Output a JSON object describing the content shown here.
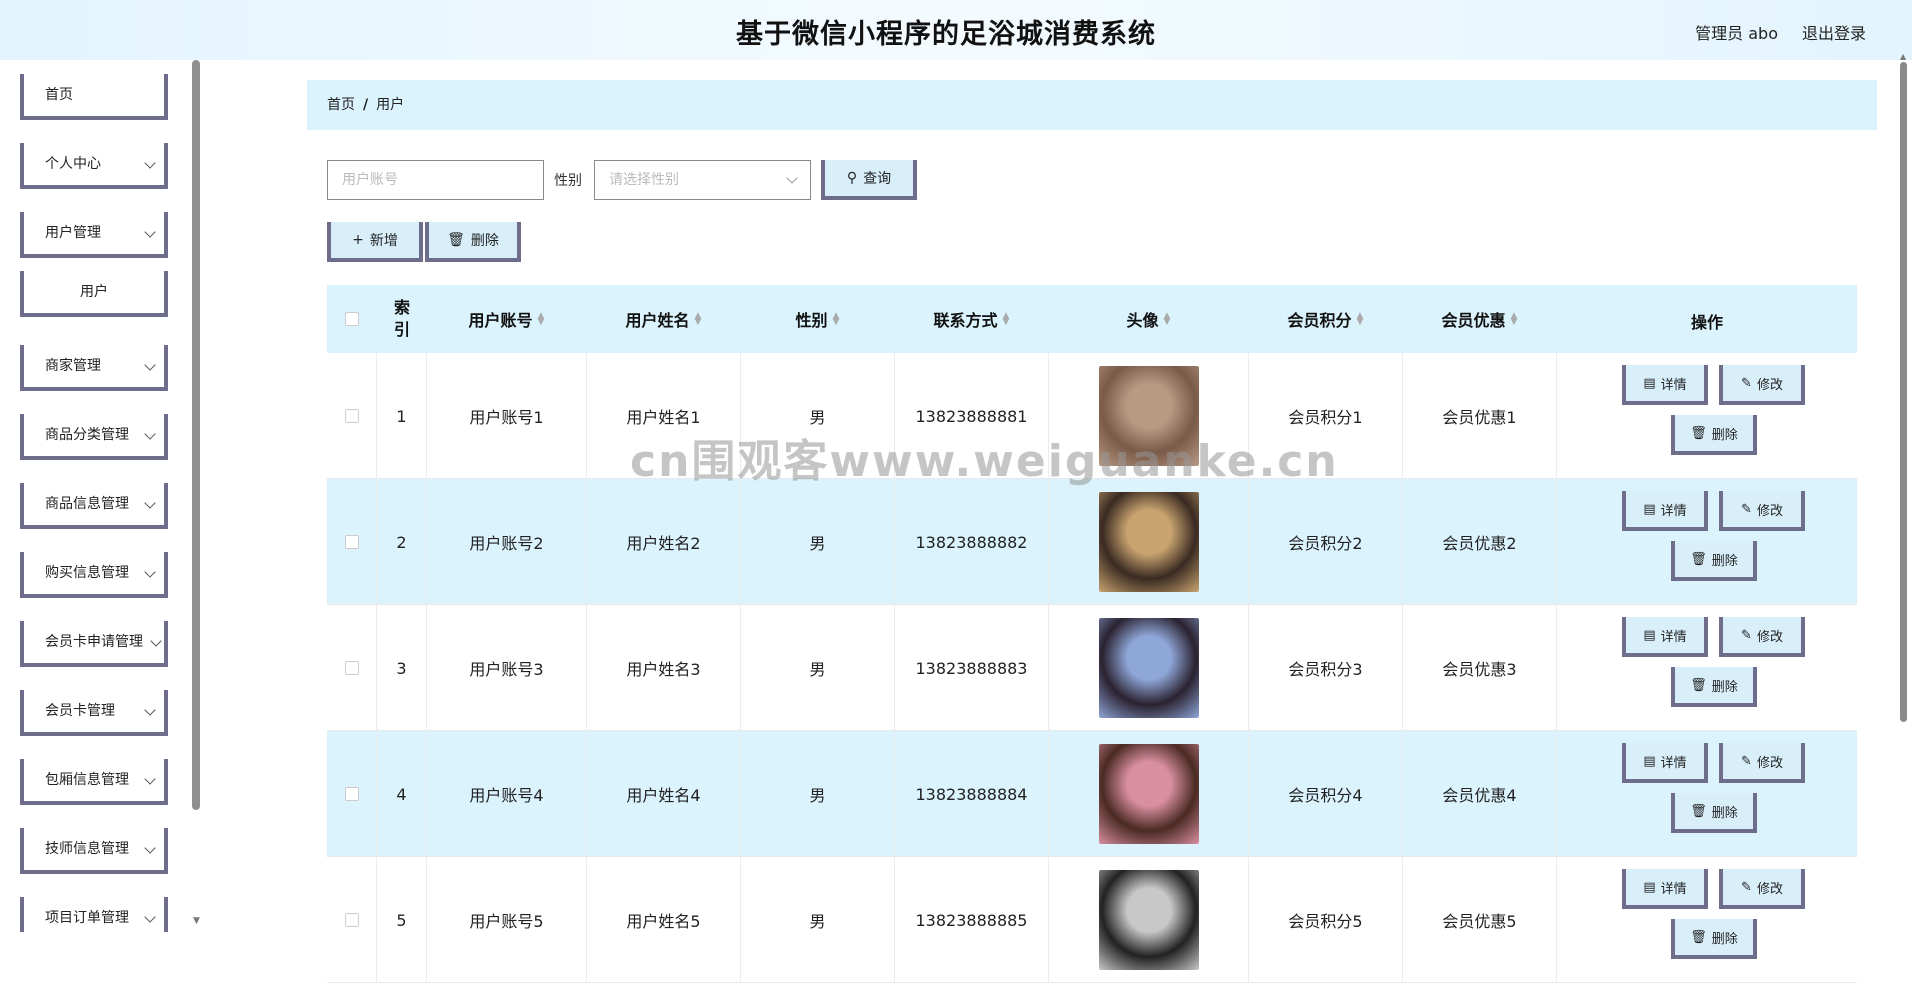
{
  "header": {
    "title": "基于微信小程序的足浴城消费系统",
    "admin": "管理员 abo",
    "logout": "退出登录"
  },
  "sidebar": {
    "items": [
      {
        "label": "首页",
        "has_chevron": false
      },
      {
        "label": "个人中心",
        "has_chevron": true
      },
      {
        "label": "用户管理",
        "has_chevron": true
      },
      {
        "label": "商家管理",
        "has_chevron": true
      },
      {
        "label": "商品分类管理",
        "has_chevron": true
      },
      {
        "label": "商品信息管理",
        "has_chevron": true
      },
      {
        "label": "购买信息管理",
        "has_chevron": true
      },
      {
        "label": "会员卡申请管理",
        "has_chevron": true
      },
      {
        "label": "会员卡管理",
        "has_chevron": true
      },
      {
        "label": "包厢信息管理",
        "has_chevron": true
      },
      {
        "label": "技师信息管理",
        "has_chevron": true
      },
      {
        "label": "项目订单管理",
        "has_chevron": true
      }
    ],
    "submenu": {
      "label": "用户"
    }
  },
  "breadcrumb": {
    "home": "首页",
    "separator": "/",
    "current": "用户"
  },
  "search": {
    "account_placeholder": "用户账号",
    "gender_label": "性别",
    "gender_placeholder": "请选择性别",
    "query_button": "查询"
  },
  "actions": {
    "add": "新增",
    "delete": "删除"
  },
  "table": {
    "headers": {
      "index": "索引",
      "account": "用户账号",
      "name": "用户姓名",
      "gender": "性别",
      "phone": "联系方式",
      "avatar": "头像",
      "points": "会员积分",
      "discount": "会员优惠",
      "ops": "操作"
    },
    "rows": [
      {
        "index": "1",
        "account": "用户账号1",
        "name": "用户姓名1",
        "gender": "男",
        "phone": "13823888881",
        "points": "会员积分1",
        "discount": "会员优惠1"
      },
      {
        "index": "2",
        "account": "用户账号2",
        "name": "用户姓名2",
        "gender": "男",
        "phone": "13823888882",
        "points": "会员积分2",
        "discount": "会员优惠2"
      },
      {
        "index": "3",
        "account": "用户账号3",
        "name": "用户姓名3",
        "gender": "男",
        "phone": "13823888883",
        "points": "会员积分3",
        "discount": "会员优惠3"
      },
      {
        "index": "4",
        "account": "用户账号4",
        "name": "用户姓名4",
        "gender": "男",
        "phone": "13823888884",
        "points": "会员积分4",
        "discount": "会员优惠4"
      },
      {
        "index": "5",
        "account": "用户账号5",
        "name": "用户姓名5",
        "gender": "男",
        "phone": "13823888885",
        "points": "会员积分5",
        "discount": "会员优惠5"
      }
    ],
    "row_ops": {
      "detail": "详情",
      "edit": "修改",
      "delete": "删除"
    }
  },
  "watermark": "cn围观客www.weiguanke.cn",
  "colors": {
    "accent_bg": "#dbf3fd",
    "button_border": "#6e6e8c",
    "header_bg": "#e3f4fd"
  }
}
